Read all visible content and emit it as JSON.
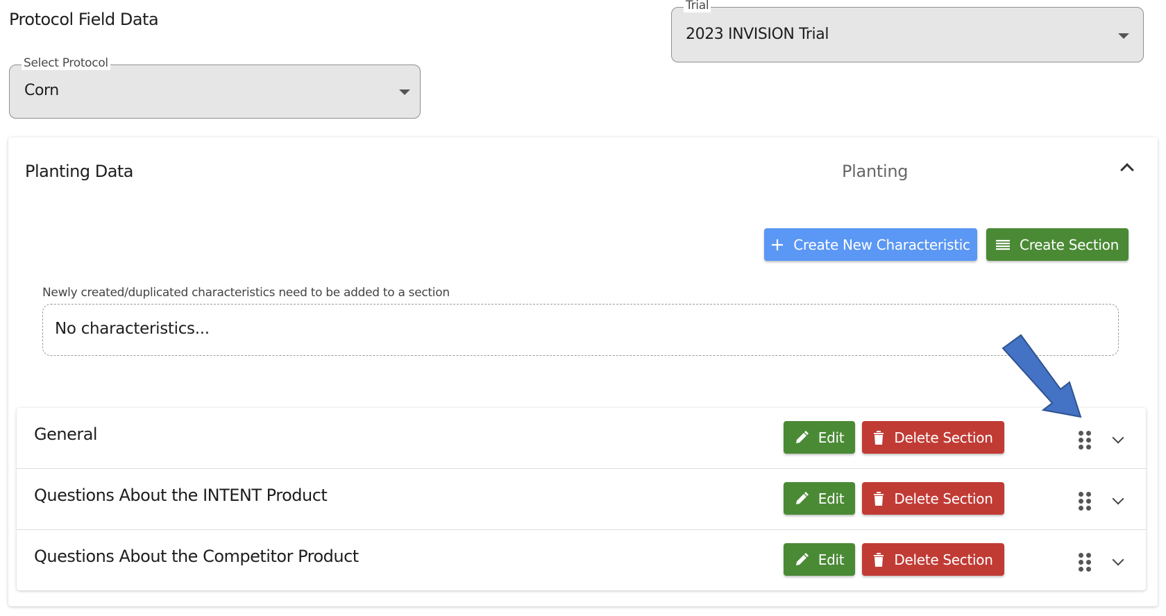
{
  "page": {
    "title": "Protocol Field Data"
  },
  "protocol_select": {
    "label": "Select Protocol",
    "value": "Corn"
  },
  "trial_select": {
    "label": "Trial",
    "value": "2023 INVISION Trial"
  },
  "card": {
    "title": "Planting Data",
    "subtitle": "Planting",
    "create_characteristic_label": "Create New Characteristic",
    "create_section_label": "Create Section",
    "hint": "Newly created/duplicated characteristics need to be added to a section",
    "empty_text": "No characteristics..."
  },
  "sections": [
    {
      "title": "General",
      "edit_label": "Edit",
      "delete_label": "Delete Section"
    },
    {
      "title": "Questions About the INTENT Product",
      "edit_label": "Edit",
      "delete_label": "Delete Section"
    },
    {
      "title": "Questions About the Competitor Product",
      "edit_label": "Edit",
      "delete_label": "Delete Section"
    }
  ],
  "colors": {
    "primary_blue": "#5b97f4",
    "success_green": "#4a8a35",
    "danger_red": "#c13b35",
    "annotation_arrow": "#4472c4"
  },
  "icons": {
    "create_characteristic": "plus-icon",
    "create_section": "list-icon",
    "edit": "pencil-icon",
    "delete": "trash-icon",
    "reorder": "drag-handle-icon",
    "expand": "chevron-down-icon",
    "collapse": "chevron-up-icon",
    "select": "caret-down-icon"
  }
}
